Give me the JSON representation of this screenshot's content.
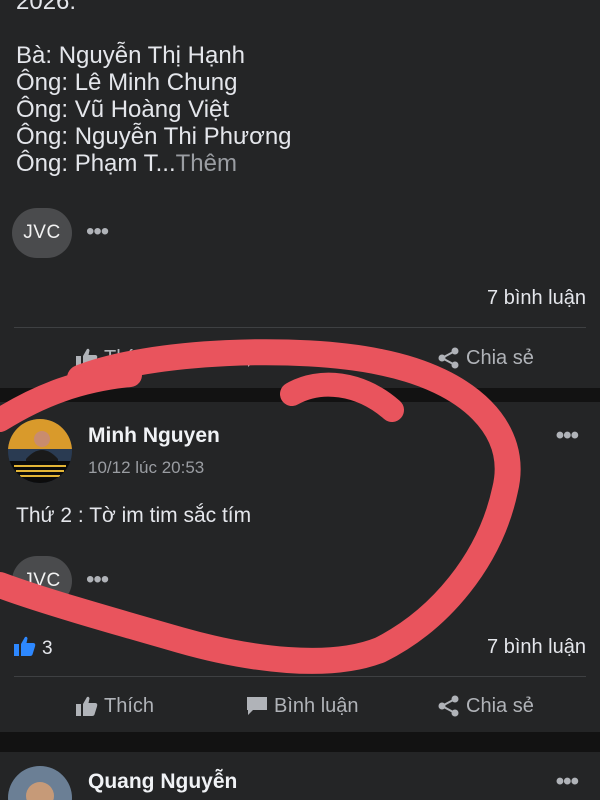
{
  "post1": {
    "text_lines": [
      "2026:",
      "",
      "Bà: Nguyễn Thị Hạnh",
      "Ông: Lê Minh Chung",
      "Ông: Vũ Hoàng Việt",
      "Ông: Nguyễn Thi Phương"
    ],
    "truncated_line": "Ông: Phạm T...",
    "more_label": "Thêm",
    "avatar_badge": "JVC",
    "dots": "•••",
    "comments": "7 bình luận",
    "actions": {
      "like": "Thích",
      "comment": "Bình luận",
      "share": "Chia sẻ"
    }
  },
  "post2": {
    "author": "Minh Nguyen",
    "time": "10/12 lúc 20:53",
    "menu": "•••",
    "text": "Thứ 2 : Tờ im tim sắc tím",
    "avatar_badge": "JVC",
    "dots": "•••",
    "likes_count": "3",
    "comments": "7 bình luận",
    "actions": {
      "like": "Thích",
      "comment": "Bình luận",
      "share": "Chia sẻ"
    }
  },
  "post3": {
    "author": "Quang Nguyễn",
    "menu": "•••"
  },
  "colors": {
    "background": "#121212",
    "card": "#242526",
    "like_blue": "#2d88ff",
    "annotation_red": "#e9545d"
  },
  "icons": [
    "thumbs-up-icon",
    "comment-icon",
    "share-icon",
    "more-icon"
  ]
}
